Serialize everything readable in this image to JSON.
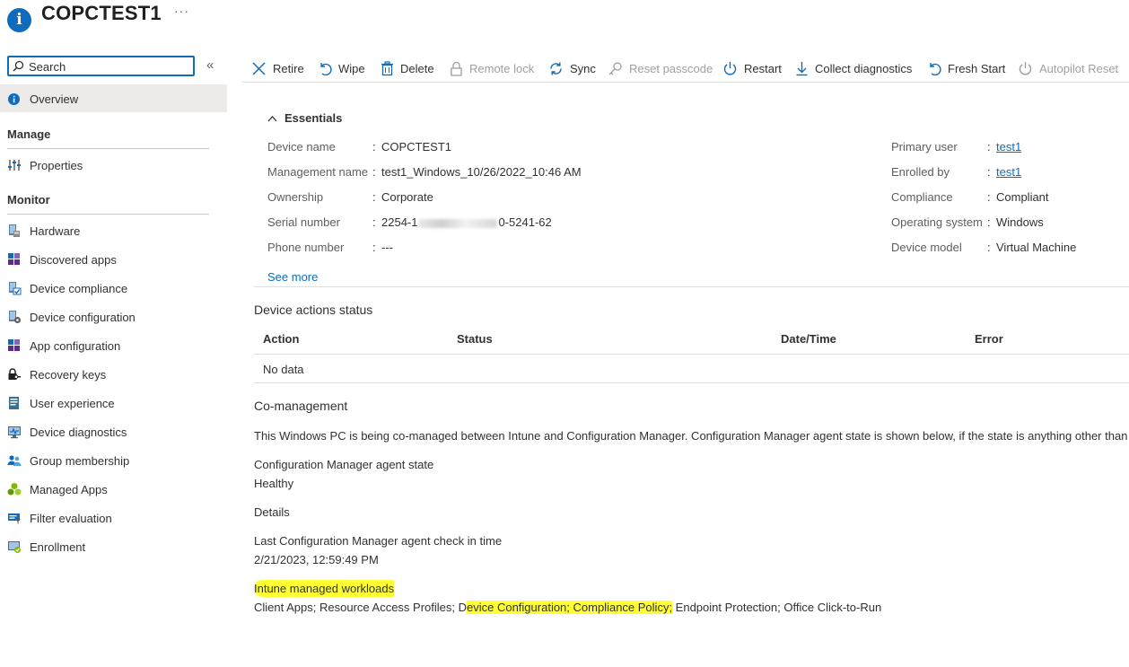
{
  "header": {
    "icon": "info-icon",
    "title": "COPCTEST1",
    "more": "···"
  },
  "sidebar": {
    "search": {
      "placeholder": "Search",
      "value": ""
    },
    "collapse": "«",
    "overview": "Overview",
    "manage_heading": "Manage",
    "manage_items": [
      {
        "label": "Properties",
        "icon": "properties-icon"
      }
    ],
    "monitor_heading": "Monitor",
    "monitor_items": [
      {
        "label": "Hardware",
        "icon": "hardware-icon"
      },
      {
        "label": "Discovered apps",
        "icon": "discovered-apps-icon"
      },
      {
        "label": "Device compliance",
        "icon": "device-compliance-icon"
      },
      {
        "label": "Device configuration",
        "icon": "device-configuration-icon"
      },
      {
        "label": "App configuration",
        "icon": "app-configuration-icon"
      },
      {
        "label": "Recovery keys",
        "icon": "lock-key-icon"
      },
      {
        "label": "User experience",
        "icon": "user-experience-icon"
      },
      {
        "label": "Device diagnostics",
        "icon": "device-diagnostics-icon"
      },
      {
        "label": "Group membership",
        "icon": "group-icon"
      },
      {
        "label": "Managed Apps",
        "icon": "managed-apps-icon"
      },
      {
        "label": "Filter evaluation",
        "icon": "filter-icon"
      },
      {
        "label": "Enrollment",
        "icon": "enrollment-icon"
      }
    ]
  },
  "toolbar": {
    "retire": "Retire",
    "wipe": "Wipe",
    "delete": "Delete",
    "remote_lock": "Remote lock",
    "sync": "Sync",
    "reset_passcode": "Reset passcode",
    "restart": "Restart",
    "collect_diagnostics": "Collect diagnostics",
    "fresh_start": "Fresh Start",
    "autopilot_reset": "Autopilot Reset"
  },
  "essentials": {
    "heading": "Essentials",
    "separator": ":",
    "left": [
      {
        "key": "Device name",
        "value": "COPCTEST1"
      },
      {
        "key": "Management name",
        "value": "test1_Windows_10/26/2022_10:46 AM"
      },
      {
        "key": "Ownership",
        "value": "Corporate"
      },
      {
        "key": "Serial number",
        "value_start": "2254-1",
        "value_end": "0-5241-62"
      },
      {
        "key": "Phone number",
        "value": "---"
      }
    ],
    "right": [
      {
        "key": "Primary user",
        "value": "test1"
      },
      {
        "key": "Enrolled by",
        "value": "test1"
      },
      {
        "key": "Compliance",
        "value": "Compliant"
      },
      {
        "key": "Operating system",
        "value": "Windows"
      },
      {
        "key": "Device model",
        "value": "Virtual Machine"
      }
    ],
    "see_more": "See more"
  },
  "device_actions": {
    "title": "Device actions status",
    "columns": [
      "Action",
      "Status",
      "Date/Time",
      "Error"
    ],
    "empty_text": "No data"
  },
  "co_management": {
    "title": "Co-management",
    "description": "This Windows PC is being co-managed between Intune and Configuration Manager. Configuration Manager agent state is shown below, if the state is anything other than",
    "agent_state_label": "Configuration Manager agent state",
    "agent_state_value": "Healthy",
    "details_label": "Details",
    "last_checkin_label": "Last Configuration Manager agent check in time",
    "last_checkin_value": "2/21/2023, 12:59:49 PM",
    "workloads_label": "Intune managed workloads",
    "workloads": [
      {
        "text": "Client Apps; Resource Access Profiles; D",
        "highlighted": false
      },
      {
        "text": "evice Configuration; Compliance Policy;",
        "highlighted": true
      },
      {
        "text": " Endpoint Protection; Office Click-to-Run",
        "highlighted": false
      }
    ],
    "highlight_color": "#ffff33"
  },
  "colors": {
    "accent": "#0f6cbd",
    "disabled": "#a19f9d",
    "selected_bg": "#edebe9"
  }
}
